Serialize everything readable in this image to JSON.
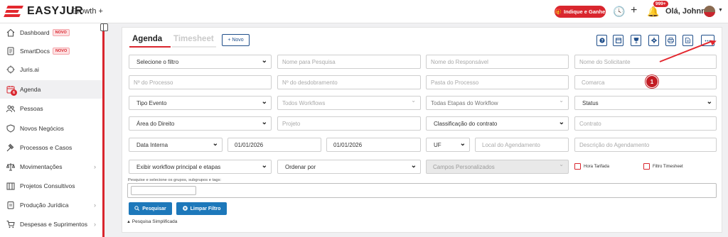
{
  "brand": {
    "name": "EASYJUR",
    "plan": "Growth +",
    "accent": "#d9262e"
  },
  "topbar": {
    "indique": "Indique e Ganhe",
    "notifications": "999+",
    "greeting": "Olá, Johnny"
  },
  "sidebar": {
    "items": [
      {
        "label": "Dashboard",
        "badge": "NOVO",
        "icon": "home-icon"
      },
      {
        "label": "SmartDocs",
        "badge": "NOVO",
        "icon": "document-icon"
      },
      {
        "label": "Juris.ai",
        "icon": "ai-icon"
      },
      {
        "label": "Agenda",
        "icon": "calendar-icon",
        "count": "6",
        "active": true
      },
      {
        "label": "Pessoas",
        "icon": "people-icon"
      },
      {
        "label": "Novos Negócios",
        "icon": "shield-icon"
      },
      {
        "label": "Processos e Casos",
        "icon": "gavel-icon"
      },
      {
        "label": "Movimentações",
        "icon": "scale-icon",
        "chevron": true
      },
      {
        "label": "Projetos Consultivos",
        "icon": "columns-icon"
      },
      {
        "label": "Produção Jurídica",
        "icon": "clipboard-icon",
        "chevron": true
      },
      {
        "label": "Despesas e Suprimentos",
        "icon": "cart-icon",
        "chevron": true
      }
    ]
  },
  "tabs": {
    "agenda": "Agenda",
    "timesheet": "Timesheet"
  },
  "novo_button": "+ Novo",
  "toolbar": [
    "help-icon",
    "calendar-icon",
    "trophy-icon",
    "gear-icon",
    "print-icon",
    "export-icon",
    "more-icon"
  ],
  "filters": {
    "row1": {
      "selecione": "Selecione o filtro",
      "pesquisa": "Nome para Pesquisa",
      "responsavel": "Nome do Responsável",
      "solicitante": "Nome do Solicitante"
    },
    "row2": {
      "processo": "Nº do Processo",
      "desdobramento": "Nº do desdobramento",
      "pasta": "Pasta do Processo",
      "comarca": "Comarca"
    },
    "row3": {
      "tipo_evento": "Tipo Evento",
      "workflows": "Todos Workflows",
      "etapas": "Todas Etapas do Workflow",
      "status": "Status"
    },
    "row4": {
      "area": "Área do Direito",
      "projeto": "Projeto",
      "classificacao": "Classificação do contrato",
      "contrato": "Contrato"
    },
    "row5": {
      "data_tipo": "Data Interna",
      "data_inicio": "01/01/2026",
      "data_fim": "01/01/2026",
      "uf": "UF",
      "local": "Local do Agendamento",
      "descricao": "Descrição do Agendamento"
    },
    "row6": {
      "exibir": "Exibir workflow principal e etapas",
      "ordenar": "Ordenar por",
      "campos": "Campos Personalizados",
      "hora_tarifada": "Hora Tarifada",
      "filtro_timesheet": "Filtro Timesheet"
    }
  },
  "hint": "Pesquise e selecione os grupos, subgrupos e tags:",
  "buttons": {
    "pesquisar": "Pesquisar",
    "limpar": "Limpar Filtro"
  },
  "simplificada": "Pesquisa Simplificada",
  "annotation_number": "1"
}
